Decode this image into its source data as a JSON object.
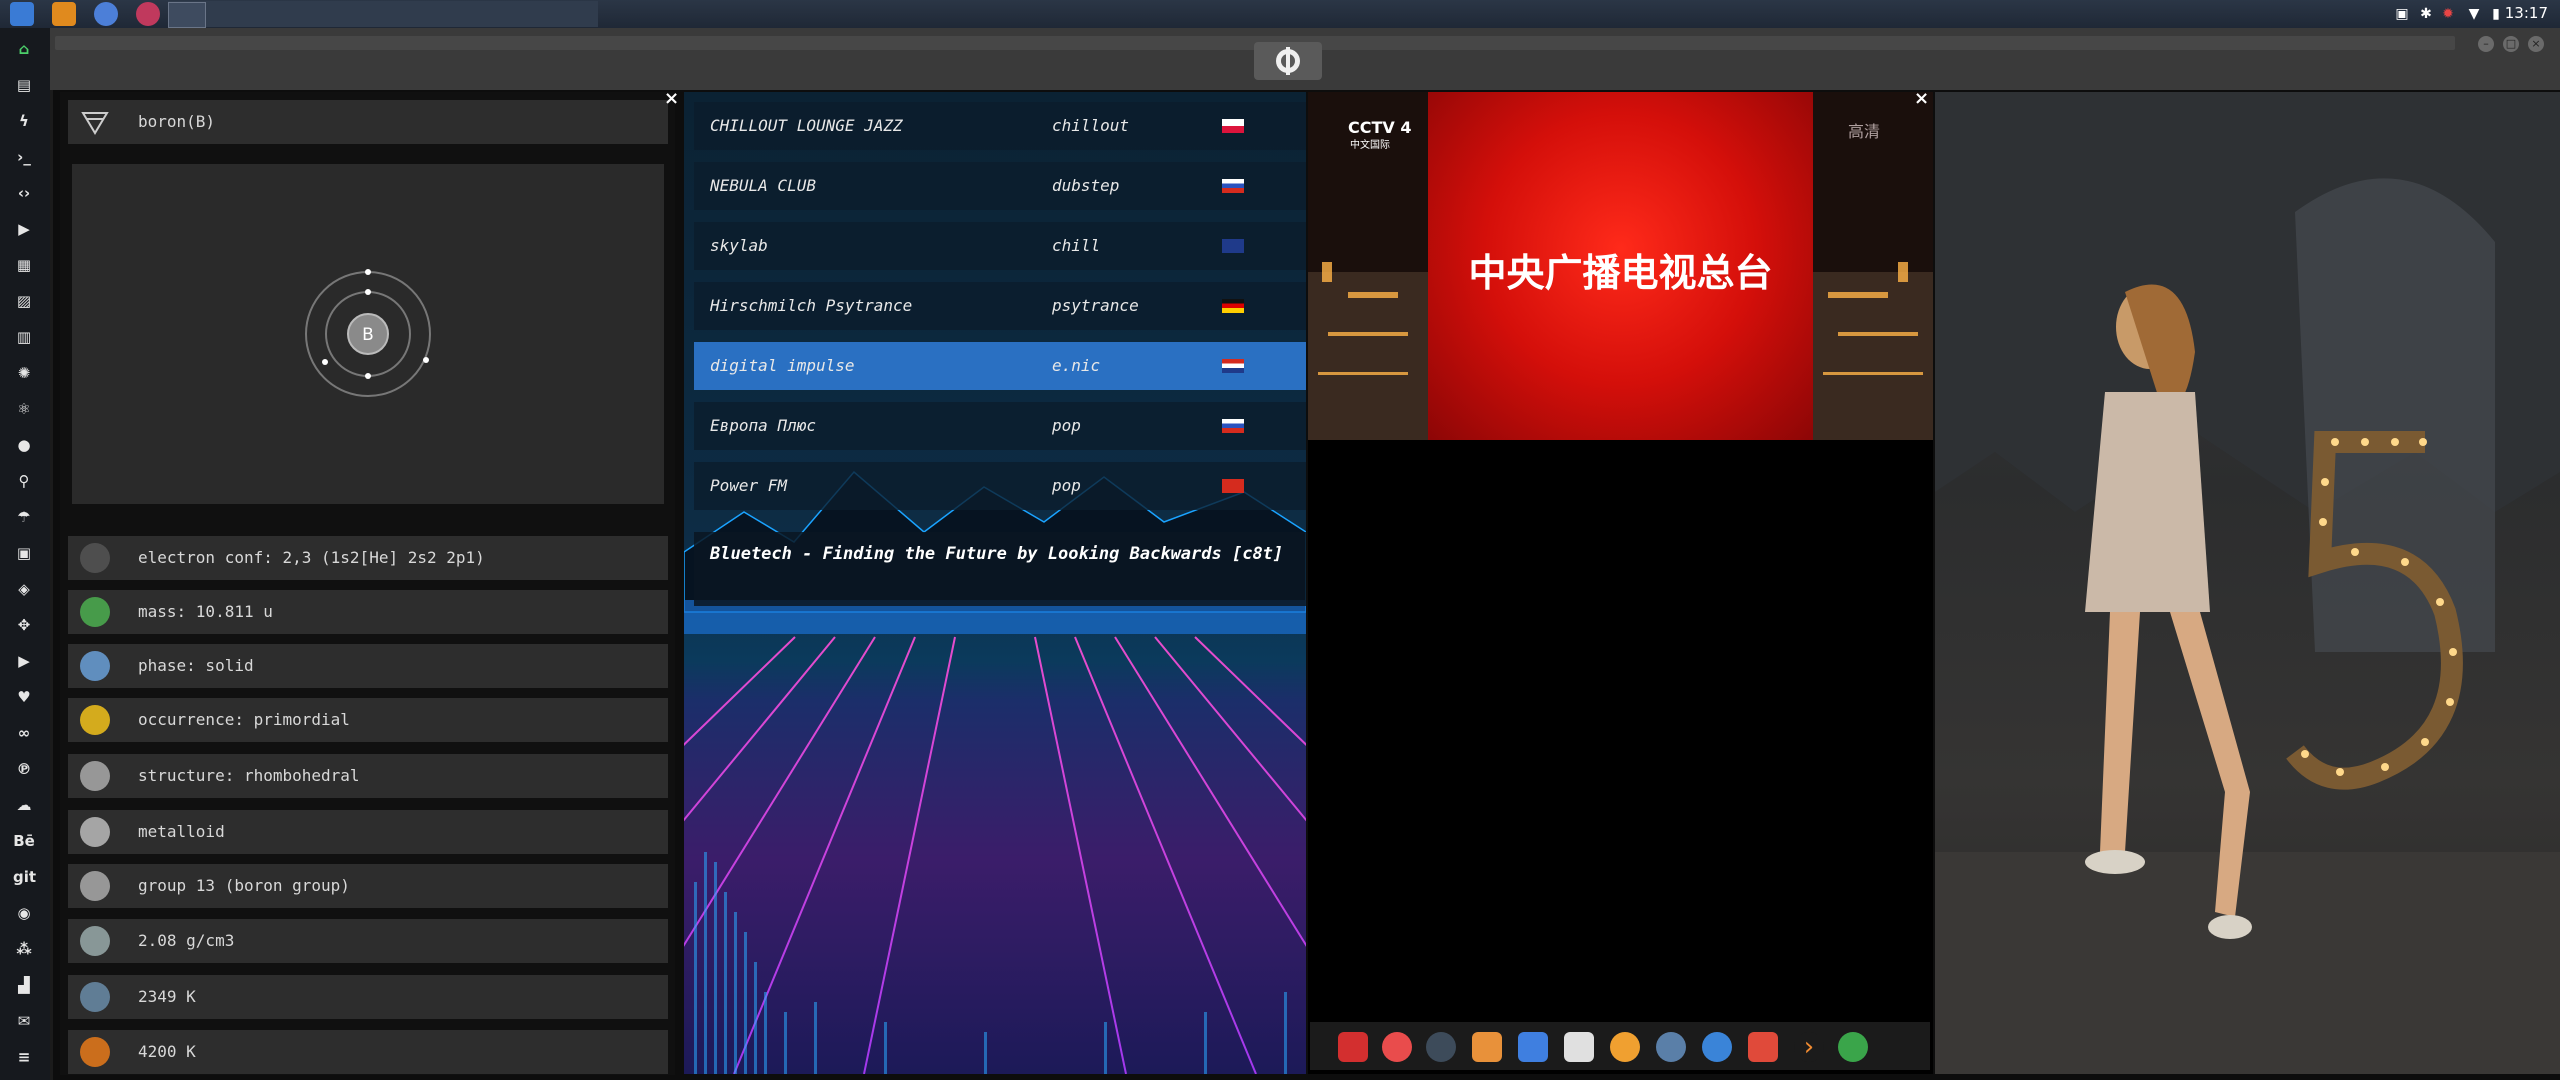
{
  "clock": "13:17",
  "element": {
    "title": "boron(B)",
    "symbol": "B",
    "properties": [
      {
        "label": "electron conf: 2,3 (1s2[He] 2s2 2p1)",
        "icon": "electron-config-icon"
      },
      {
        "label": "mass: 10.811 u",
        "icon": "mass-icon"
      },
      {
        "label": "phase: solid",
        "icon": "atom-phase-icon"
      },
      {
        "label": "occurrence: primordial",
        "icon": "lightning-icon"
      },
      {
        "label": "structure: rhombohedral",
        "icon": "structure-icon"
      },
      {
        "label": "metalloid",
        "icon": "metalloid-icon"
      },
      {
        "label": "group 13 (boron group)",
        "icon": "group-icon"
      },
      {
        "label": "2.08 g/cm3",
        "icon": "density-icon"
      },
      {
        "label": "2349 K",
        "icon": "melting-point-icon"
      },
      {
        "label": "4200 K",
        "icon": "boiling-point-icon"
      }
    ]
  },
  "radio": {
    "stations": [
      {
        "name": "CHILLOUT LOUNGE JAZZ",
        "genre": "chillout",
        "flag": "poland"
      },
      {
        "name": "NEBULA CLUB",
        "genre": "dubstep",
        "flag": "russia"
      },
      {
        "name": "skylab",
        "genre": "chill",
        "flag": "uk"
      },
      {
        "name": "Hirschmilch Psytrance",
        "genre": "psytrance",
        "flag": "germany"
      },
      {
        "name": "digital impulse",
        "genre": "e.nic",
        "flag": "croatia"
      },
      {
        "name": "Европа Плюс",
        "genre": "pop",
        "flag": "russia"
      },
      {
        "name": "Power FM",
        "genre": "pop",
        "flag": "turkey"
      }
    ],
    "now_playing": "Bluetech - Finding the Future by Looking Backwards [c8t]"
  },
  "tv": {
    "channel_logo": "CCTV 4",
    "channel_sub": "中文国际",
    "quality": "高清",
    "screen_text": "中央广播电视总台"
  },
  "colors": {
    "selected_row": "#2a70c2",
    "tv_red": "#d40f0a"
  }
}
